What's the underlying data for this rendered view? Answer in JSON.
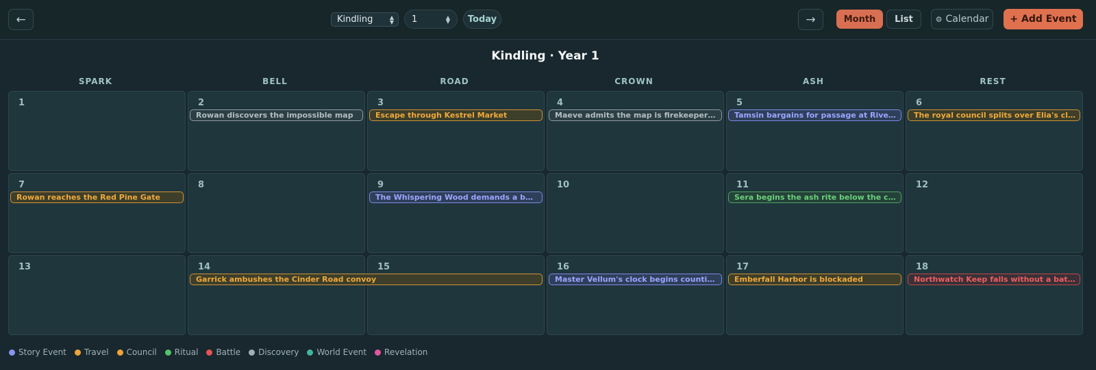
{
  "toolbar": {
    "prev_icon": "←",
    "next_icon": "→",
    "month_select": "Kindling",
    "year_value": "1",
    "today_label": "Today",
    "month_label": "Month",
    "list_label": "List",
    "calendar_icon": "⚙",
    "calendar_label": "Calendar",
    "add_event_label": "+ Add Event"
  },
  "calendar": {
    "title": "Kindling · Year 1",
    "weekdays": [
      "SPARK",
      "BELL",
      "ROAD",
      "CROWN",
      "ASH",
      "REST"
    ],
    "days": [
      "1",
      "2",
      "3",
      "4",
      "5",
      "6",
      "7",
      "8",
      "9",
      "10",
      "11",
      "12",
      "13",
      "14",
      "15",
      "16",
      "17",
      "18"
    ],
    "events": [
      {
        "label": "Rowan discovers the impossible map",
        "type": "discovery"
      },
      {
        "label": "Escape through Kestrel Market",
        "type": "travel"
      },
      {
        "label": "Maeve admits the map is firekeeper work",
        "type": "discovery"
      },
      {
        "label": "Tamsin bargains for passage at Rivergate",
        "type": "story"
      },
      {
        "label": "The royal council splits over Elia's claim",
        "type": "council"
      },
      {
        "label": "Rowan reaches the Red Pine Gate",
        "type": "travel"
      },
      {
        "label": "The Whispering Wood demands a bargain",
        "type": "story"
      },
      {
        "label": "Sera begins the ash rite below the city",
        "type": "ritual"
      },
      {
        "label": "Garrick ambushes the Cinder Road convoy",
        "type": "travel"
      },
      {
        "label": "Master Vellum's clock begins counting backward",
        "type": "story"
      },
      {
        "label": "Emberfall Harbor is blockaded",
        "type": "travel"
      },
      {
        "label": "Northwatch Keep falls without a battle",
        "type": "battle"
      }
    ]
  },
  "legend": [
    {
      "label": "Story Event",
      "color": "#8b93f0"
    },
    {
      "label": "Travel",
      "color": "#f0a33a"
    },
    {
      "label": "Council",
      "color": "#f0a33a"
    },
    {
      "label": "Ritual",
      "color": "#54c26a"
    },
    {
      "label": "Battle",
      "color": "#e55353"
    },
    {
      "label": "Discovery",
      "color": "#a2aeb3"
    },
    {
      "label": "World Event",
      "color": "#3fb5a2"
    },
    {
      "label": "Revelation",
      "color": "#e056a0"
    }
  ]
}
